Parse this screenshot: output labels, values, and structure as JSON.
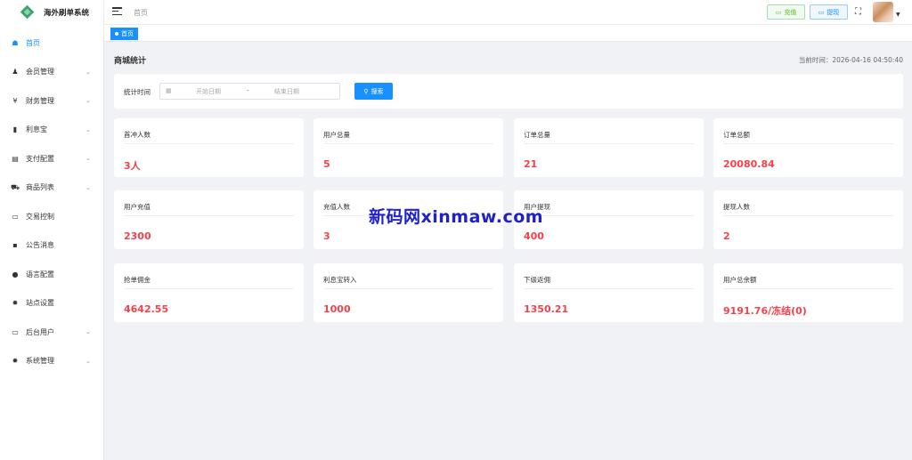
{
  "brand": {
    "name": "海外刷单系统"
  },
  "sidebar": {
    "items": [
      {
        "label": "首页",
        "icon": "dashboard-icon",
        "glyph": "☗",
        "active": true,
        "has_children": false
      },
      {
        "label": "会员管理",
        "icon": "users-icon",
        "glyph": "♟",
        "active": false,
        "has_children": true
      },
      {
        "label": "财务管理",
        "icon": "yen-icon",
        "glyph": "¥",
        "active": false,
        "has_children": true
      },
      {
        "label": "利息宝",
        "icon": "bar-chart-icon",
        "glyph": "▮",
        "active": false,
        "has_children": true
      },
      {
        "label": "支付配置",
        "icon": "payment-icon",
        "glyph": "▤",
        "active": false,
        "has_children": true
      },
      {
        "label": "商品列表",
        "icon": "cart-icon",
        "glyph": "⛟",
        "active": false,
        "has_children": true
      },
      {
        "label": "交易控制",
        "icon": "monitor-icon",
        "glyph": "▭",
        "active": false,
        "has_children": false
      },
      {
        "label": "公告消息",
        "icon": "message-icon",
        "glyph": "▪",
        "active": false,
        "has_children": false
      },
      {
        "label": "语言配置",
        "icon": "globe-icon",
        "glyph": "●",
        "active": false,
        "has_children": false
      },
      {
        "label": "站点设置",
        "icon": "gear-icon",
        "glyph": "✹",
        "active": false,
        "has_children": false
      },
      {
        "label": "后台用户",
        "icon": "monitor-icon",
        "glyph": "▭",
        "active": false,
        "has_children": true
      },
      {
        "label": "系统管理",
        "icon": "gear-icon",
        "glyph": "✹",
        "active": false,
        "has_children": true
      }
    ]
  },
  "header": {
    "breadcrumb": "首页",
    "recharge_label": "充值",
    "withdraw_label": "提现"
  },
  "tabs": {
    "active_tab": "首页"
  },
  "main": {
    "title": "商城统计",
    "current_time_label": "当前时间：",
    "current_time": "2026-04-16 04:50:40",
    "filter_label": "统计时间",
    "start_placeholder": "开始日期",
    "range_separator": "-",
    "end_placeholder": "结束日期",
    "search_label": "搜索"
  },
  "stats": [
    {
      "label": "首冲人数",
      "value": "3人"
    },
    {
      "label": "用户总量",
      "value": "5"
    },
    {
      "label": "订单总量",
      "value": "21"
    },
    {
      "label": "订单总额",
      "value": "20080.84"
    },
    {
      "label": "用户充值",
      "value": "2300"
    },
    {
      "label": "充值人数",
      "value": "3"
    },
    {
      "label": "用户提现",
      "value": "400"
    },
    {
      "label": "提现人数",
      "value": "2"
    },
    {
      "label": "抢单佣金",
      "value": "4642.55"
    },
    {
      "label": "利息宝转入",
      "value": "1000"
    },
    {
      "label": "下级返佣",
      "value": "1350.21"
    },
    {
      "label": "用户总余额",
      "value": "9191.76/冻结(0)"
    }
  ],
  "watermark": "新码网xinmaw.com",
  "colors": {
    "accent": "#1890ff",
    "value_red": "#f5424a",
    "success": "#52c41a",
    "logo_green": "#3aa56b"
  }
}
